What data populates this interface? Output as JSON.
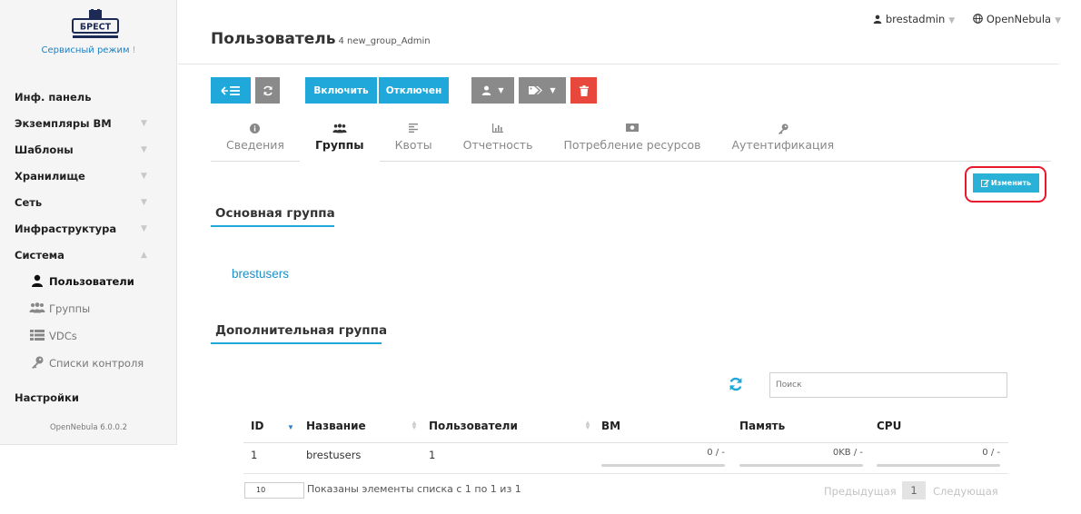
{
  "brand": {
    "name": "БРЕСТ",
    "mode": "Сервисный режим",
    "mode_marker": "!",
    "accent": "#1f7fc1"
  },
  "sidebar": {
    "items": [
      {
        "label": "Инф. панель"
      },
      {
        "label": "Экземпляры ВМ"
      },
      {
        "label": "Шаблоны"
      },
      {
        "label": "Хранилище"
      },
      {
        "label": "Сеть"
      },
      {
        "label": "Инфраструктура"
      },
      {
        "label": "Система"
      }
    ],
    "system_sub": [
      {
        "label": "Пользователи",
        "icon": "user-icon",
        "active": true
      },
      {
        "label": "Группы",
        "icon": "users-icon"
      },
      {
        "label": "VDCs",
        "icon": "list-icon"
      },
      {
        "label": "Списки контроля",
        "icon": "key-icon"
      }
    ],
    "settings": "Настройки",
    "version": "OpenNebula 6.0.0.2"
  },
  "topbar": {
    "user": "brestadmin",
    "zone": "OpenNebula"
  },
  "header": {
    "title": "Пользователь",
    "subtitle": "4 new_group_Admin"
  },
  "toolbar": {
    "enable_label": "Включить",
    "disable_label": "Отключен",
    "colors": {
      "blue": "#1fa8d9",
      "grey": "#8a8a8a",
      "red": "#e8473b"
    }
  },
  "tabs": [
    {
      "label": "Сведения",
      "icon": "info-icon"
    },
    {
      "label": "Группы",
      "icon": "users-icon",
      "active": true
    },
    {
      "label": "Квоты",
      "icon": "align-icon"
    },
    {
      "label": "Отчетность",
      "icon": "bar-chart-icon"
    },
    {
      "label": "Потребление ресурсов",
      "icon": "money-icon"
    },
    {
      "label": "Аутентификация",
      "icon": "key-icon"
    }
  ],
  "edit_label": "Изменить",
  "primary_group": {
    "heading": "Основная группа",
    "value": "brestusers"
  },
  "secondary_group": {
    "heading": "Дополнительная группа"
  },
  "table": {
    "search_placeholder": "Поиск",
    "columns": [
      "ID",
      "Название",
      "Пользователи",
      "ВМ",
      "Память",
      "CPU"
    ],
    "rows": [
      {
        "id": "1",
        "name": "brestusers",
        "users": "1",
        "vm": "0 / -",
        "memory": "0KB / -",
        "cpu": "0 / -"
      }
    ],
    "page_length": "10",
    "info": "Показаны элементы списка с 1 по 1 из 1",
    "prev": "Предыдущая",
    "page": "1",
    "next": "Следующая"
  }
}
